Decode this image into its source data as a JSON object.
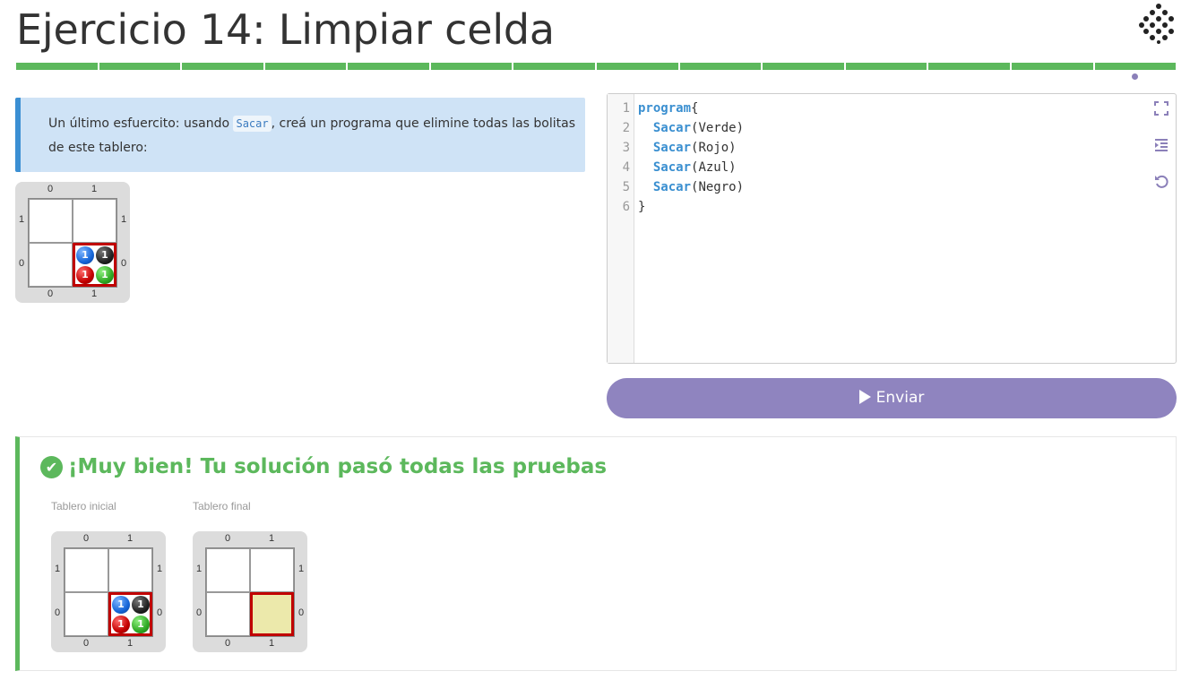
{
  "header": {
    "title": "Ejercicio 14: Limpiar celda",
    "progress_segments_completed": 14,
    "progress_segments_total": 14
  },
  "statement": {
    "text_before": "Un último esfuercito: usando ",
    "code": "Sacar",
    "text_after": ", creá un programa que elimine todas las bolitas de este tablero:"
  },
  "board_labels": {
    "cols": [
      "0",
      "1"
    ],
    "rows": [
      "1",
      "0"
    ],
    "ball_count": "1"
  },
  "editor": {
    "line_numbers": [
      "1",
      "2",
      "3",
      "4",
      "5",
      "6"
    ],
    "lines": [
      {
        "kw": "program",
        "rest": "{"
      },
      {
        "kw": "  Sacar",
        "rest": "(Verde)"
      },
      {
        "kw": "  Sacar",
        "rest": "(Rojo)"
      },
      {
        "kw": "  Sacar",
        "rest": "(Azul)"
      },
      {
        "kw": "  Sacar",
        "rest": "(Negro)"
      },
      {
        "kw": "",
        "rest": "}"
      }
    ]
  },
  "submit": {
    "label": "Enviar"
  },
  "result": {
    "title": "¡Muy bien! Tu solución pasó todas las pruebas",
    "initial_caption": "Tablero inicial",
    "final_caption": "Tablero final"
  },
  "colors": {
    "accent": "#8f84bf",
    "success": "#5cb85c",
    "info_bg": "#cfe3f6",
    "head": "#c00000"
  }
}
